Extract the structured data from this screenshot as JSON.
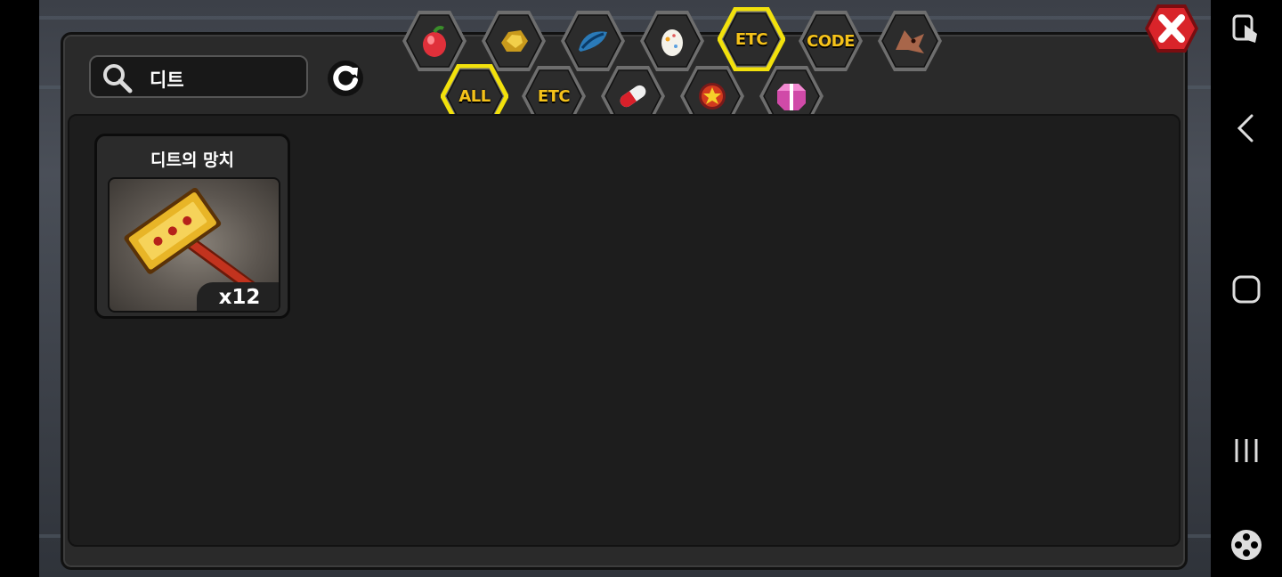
{
  "search": {
    "value": "디트"
  },
  "top_tabs": [
    {
      "id": "fruit",
      "icon": "pear-fruit-icon",
      "label": ""
    },
    {
      "id": "ore",
      "icon": "gold-ore-icon",
      "label": ""
    },
    {
      "id": "material",
      "icon": "blue-feather-icon",
      "label": ""
    },
    {
      "id": "egg",
      "icon": "egg-icon",
      "label": ""
    },
    {
      "id": "etc",
      "icon": "",
      "label": "ETC",
      "selected": true
    },
    {
      "id": "code",
      "icon": "",
      "label": "CODE"
    },
    {
      "id": "dragon",
      "icon": "dragon-head-icon",
      "label": ""
    }
  ],
  "sub_tabs": [
    {
      "id": "all",
      "icon": "",
      "label": "ALL",
      "selected": true
    },
    {
      "id": "etc",
      "icon": "",
      "label": "ETC"
    },
    {
      "id": "pill",
      "icon": "capsule-pill-icon",
      "label": ""
    },
    {
      "id": "badge",
      "icon": "star-badge-icon",
      "label": ""
    },
    {
      "id": "gift",
      "icon": "gift-box-icon",
      "label": ""
    }
  ],
  "items": [
    {
      "name": "디트의 망치",
      "count": "x12",
      "icon": "golden-hammer-icon"
    }
  ],
  "colors": {
    "tab_label": "#f5c21a",
    "selected_glow": "#f2e10c",
    "close_red": "#d9242a"
  }
}
